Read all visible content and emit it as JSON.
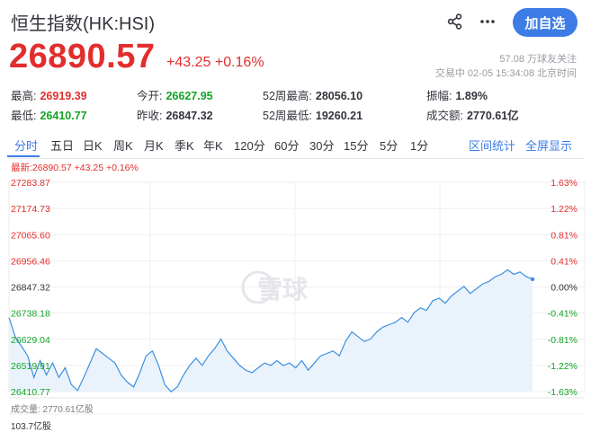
{
  "header": {
    "title": "恒生指数(HK:HSI)",
    "add_button": "加自选",
    "icons": [
      "share-icon",
      "more-icon"
    ]
  },
  "quote": {
    "price": "26890.57",
    "change": "+43.25",
    "change_pct": "+0.16%",
    "followers": "57.08 万球友关注",
    "status": "交易中 02-05 15:34:08 北京时间"
  },
  "stats": [
    {
      "label": "最高:",
      "value": "26919.39",
      "color": "#e32d2d"
    },
    {
      "label": "今开:",
      "value": "26627.95",
      "color": "#13a327"
    },
    {
      "label": "52周最高:",
      "value": "28056.10",
      "color": "#33353c"
    },
    {
      "label": "振幅:",
      "value": "1.89%",
      "color": "#33353c"
    },
    {
      "label": "最低:",
      "value": "26410.77",
      "color": "#13a327"
    },
    {
      "label": "昨收:",
      "value": "26847.32",
      "color": "#33353c"
    },
    {
      "label": "52周最低:",
      "value": "19260.21",
      "color": "#33353c"
    },
    {
      "label": "成交额:",
      "value": "2770.61亿",
      "color": "#33353c"
    }
  ],
  "tabs": [
    "分时",
    "五日",
    "日K",
    "周K",
    "月K",
    "季K",
    "年K",
    "120分",
    "60分",
    "30分",
    "15分",
    "5分",
    "1分"
  ],
  "active_tab": "分时",
  "right_tabs": [
    "区间统计",
    "全屏显示"
  ],
  "legend": "最新:26890.57 +43.25 +0.16%",
  "watermark": "雪球",
  "volume_label": "成交量: 2770.61亿股",
  "volume_max": "103.7亿股",
  "colors": {
    "up": "#e32d2d",
    "down": "#13a327",
    "accent": "#3d7ce6",
    "line": "#3d8fe0",
    "fill": "#eaf3fc"
  },
  "chart_data": {
    "type": "line",
    "ylim": [
      26410.77,
      27283.87
    ],
    "y_ticks_left": [
      "27283.87",
      "27174.73",
      "27065.60",
      "26956.46",
      "26847.32",
      "26738.18",
      "26629.04",
      "26519.91",
      "26410.77"
    ],
    "y_ticks_right": [
      "1.63%",
      "1.22%",
      "0.81%",
      "0.41%",
      "0.00%",
      "-0.41%",
      "-0.81%",
      "-1.22%",
      "-1.63%"
    ],
    "reference": 26847.32,
    "grid": true,
    "series": [
      {
        "values": [
          26720,
          26640,
          26600,
          26560,
          26470,
          26540,
          26480,
          26530,
          26470,
          26510,
          26440,
          26415,
          26470,
          26530,
          26590,
          26570,
          26550,
          26530,
          26480,
          26450,
          26430,
          26490,
          26560,
          26580,
          26520,
          26440,
          26410,
          26430,
          26480,
          26520,
          26550,
          26520,
          26560,
          26590,
          26630,
          26580,
          26550,
          26520,
          26500,
          26490,
          26510,
          26530,
          26520,
          26540,
          26520,
          26530,
          26510,
          26540,
          26500,
          26530,
          26560,
          26570,
          26580,
          26560,
          26620,
          26660,
          26640,
          26620,
          26630,
          26660,
          26680,
          26690,
          26700,
          26720,
          26700,
          26740,
          26760,
          26750,
          26790,
          26800,
          26780,
          26810,
          26830,
          26850,
          26820,
          26840,
          26860,
          26870,
          26890,
          26900,
          26919,
          26900,
          26910,
          26890,
          26880
        ]
      }
    ]
  }
}
